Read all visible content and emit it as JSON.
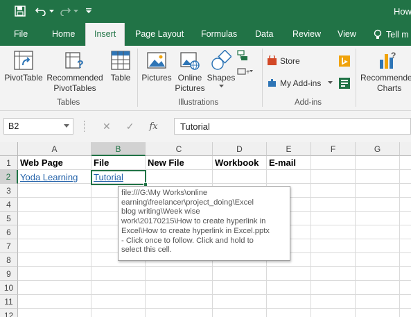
{
  "window": {
    "title": "How"
  },
  "tabs": [
    "File",
    "Home",
    "Insert",
    "Page Layout",
    "Formulas",
    "Data",
    "Review",
    "View"
  ],
  "active_tab": "Insert",
  "tell_me": "Tell m",
  "ribbon": {
    "tables": {
      "pivot": "PivotTable",
      "rec_line1": "Recommended",
      "rec_line2": "PivotTables",
      "table": "Table",
      "group": "Tables"
    },
    "illustrations": {
      "pictures": "Pictures",
      "online1": "Online",
      "online2": "Pictures",
      "shapes": "Shapes",
      "group": "Illustrations"
    },
    "addins": {
      "store": "Store",
      "my_addins": "My Add-ins",
      "group": "Add-ins"
    },
    "charts": {
      "rec1": "Recommende",
      "rec2": "Charts"
    }
  },
  "formula_bar": {
    "name_box": "B2",
    "fx": "fx",
    "content": "Tutorial"
  },
  "columns": [
    "A",
    "B",
    "C",
    "D",
    "E",
    "F",
    "G"
  ],
  "rows": [
    "1",
    "2",
    "3",
    "4",
    "5",
    "6",
    "7",
    "8",
    "9",
    "10",
    "11",
    "12"
  ],
  "cells": {
    "A1": "Web Page",
    "B1": "File",
    "C1": "New File",
    "D1": "Workbook",
    "E1": "E-mail",
    "A2": "Yoda Learning",
    "B2": "Tutorial"
  },
  "tooltip": {
    "lines": [
      "file:///G:\\My Works\\online",
      "earning\\freelancer\\project_doing\\Excel",
      "blog writing\\Week wise",
      "work\\20170215\\How to create hyperlink in",
      "Excel\\How to create hyperlink in Excel.pptx",
      "- Click once to follow. Click and hold to",
      "select this cell."
    ]
  },
  "colors": {
    "brand": "#217346",
    "link": "#1f5fa8"
  }
}
